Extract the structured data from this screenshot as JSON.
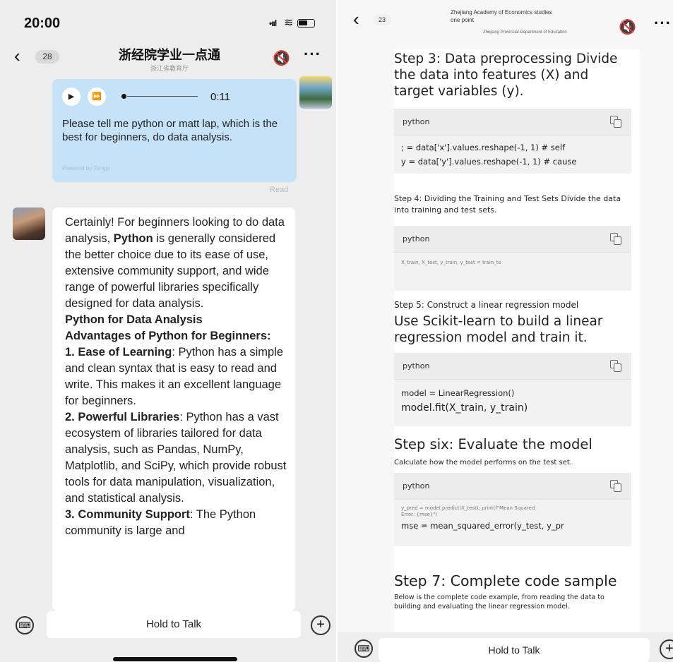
{
  "left": {
    "status": {
      "time": "20:00",
      "signal": "•ııl",
      "wifi": "≋"
    },
    "header": {
      "back_count": "28",
      "title": "浙经院学业一点通",
      "subtitle": "浙江省教育厅"
    },
    "user_message": {
      "duration": "0:11",
      "text": "Please tell me python or matt lap, which is the best for beginners, do data analysis.",
      "powered": "Powered by Tongyi",
      "status": "Read"
    },
    "bot_message": {
      "intro_pre": "Certainly! For beginners looking to do data analysis, ",
      "intro_bold": "Python",
      "intro_post": " is generally considered the better choice due to its ease of use, extensive community support, and wide range of powerful libraries specifically designed for data analysis.",
      "h1": "Python for Data Analysis",
      "h2": "Advantages of Python for Beginners:",
      "p1_bold": "1. Ease of Learning",
      "p1_text": ": Python has a simple and clean syntax that is easy to read and write. This makes it an excellent language for beginners.",
      "p2_bold": "2. Powerful Libraries",
      "p2_text": ": Python has a vast ecosystem of libraries tailored for data analysis, such as Pandas, NumPy, Matplotlib, and SciPy, which provide robust tools for data manipulation, visualization, and statistical analysis.",
      "p3_bold": "3. Community Support",
      "p3_text": ": The Python community is large and"
    },
    "input": {
      "hold_label": "Hold to Talk"
    }
  },
  "right": {
    "header": {
      "back_count": "23",
      "title_line1": "Zhejiang Academy of Economics studies one point",
      "title_line2": "Zhejiang Provincial Department of Education"
    },
    "doc": {
      "step3_title": "Step 3: Data preprocessing Divide the data into features (X) and target variables (y).",
      "code1_lang": "python",
      "code1_line1": "; = data['x'].values.reshape(-1, 1) # self",
      "code1_line2": "y = data['y'].values.reshape(-1, 1) # cause",
      "step4_title": "Step 4: Dividing the Training and Test Sets Divide the data into training and test sets.",
      "code2_lang": "python",
      "code2_line1": "X_train, X_test, y_train, y_test = train_te",
      "step5_title": "Step 5: Construct a linear regression model",
      "step5_desc": "Use Scikit-learn to build a linear regression model and train it.",
      "code3_lang": "python",
      "code3_line1": "model = LinearRegression()",
      "code3_line2": "model.fit(X_train, y_train)",
      "step6_title": "Step six: Evaluate the model",
      "step6_desc": "Calculate how the model performs on the test set.",
      "code4_lang": "python",
      "code4_line1": "y_pred = model.predict(X_test); print(f\"Mean Squared Error: {mse}\")",
      "code4_line2": "mse = mean_squared_error(y_test, y_pr",
      "step7_title": "Step 7: Complete code sample",
      "step7_desc": "Below is the complete code example, from reading the data to building and evaluating the linear regression model."
    },
    "input": {
      "hold_label": "Hold to Talk"
    }
  }
}
